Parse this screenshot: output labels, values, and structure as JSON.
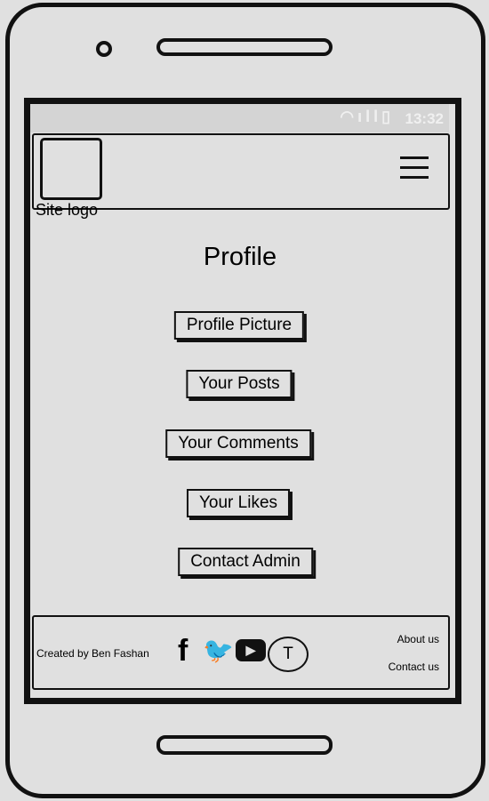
{
  "status_bar": {
    "time": "13:32",
    "icons": [
      "wifi-icon",
      "signal-icon",
      "battery-icon"
    ]
  },
  "header": {
    "logo_label": "Site logo",
    "menu_icon": "hamburger-menu-icon"
  },
  "main": {
    "title": "Profile",
    "buttons": [
      "Profile Picture",
      "Your Posts",
      "Your Comments",
      "Your Likes",
      "Contact Admin"
    ]
  },
  "footer": {
    "credit": "Created by Ben Fashan",
    "social": {
      "facebook": "f",
      "twitter": "🐦",
      "youtube": "▶",
      "t_badge": "T"
    },
    "links": [
      "About us",
      "Contact us"
    ]
  }
}
